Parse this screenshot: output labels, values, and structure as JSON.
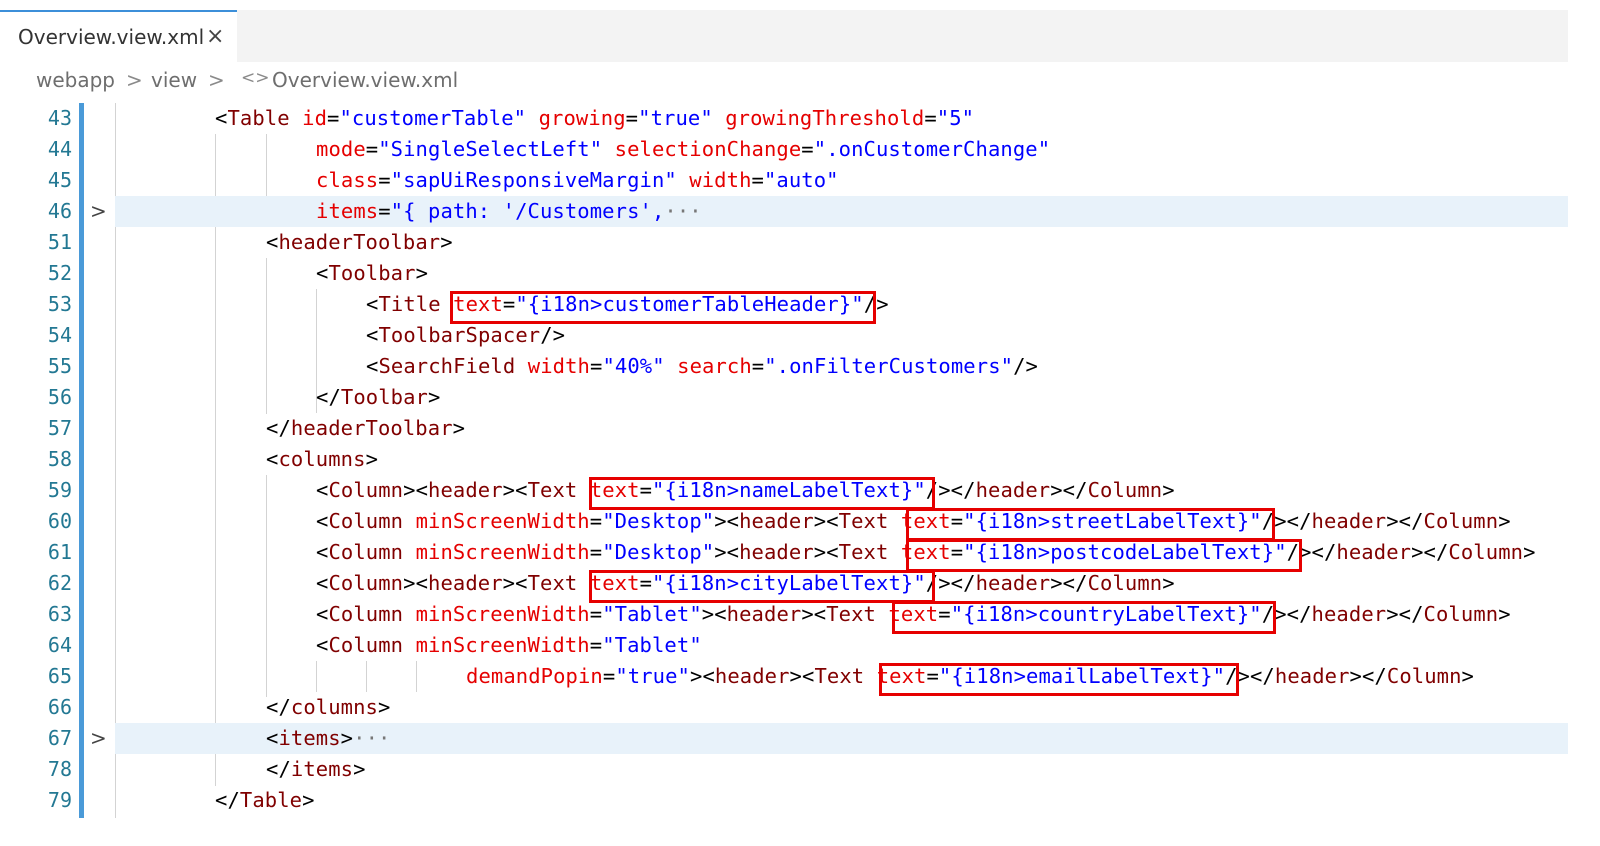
{
  "tab": {
    "label": "Overview.view.xml",
    "close_icon": "×"
  },
  "breadcrumb": {
    "items": [
      "webapp",
      "view",
      "Overview.view.xml"
    ],
    "separator": ">",
    "file_icon": "<>"
  },
  "lines": [
    {
      "num": "43",
      "text": "<Table id=\"customerTable\" growing=\"true\" growingThreshold=\"5\""
    },
    {
      "num": "44",
      "text": "mode=\"SingleSelectLeft\" selectionChange=\".onCustomerChange\""
    },
    {
      "num": "45",
      "text": "class=\"sapUiResponsiveMargin\" width=\"auto\""
    },
    {
      "num": "46",
      "text": "items=\"{ path: '/Customers',",
      "fold": ">",
      "folded": "···"
    },
    {
      "num": "51",
      "text": "<headerToolbar>"
    },
    {
      "num": "52",
      "text": "<Toolbar>"
    },
    {
      "num": "53",
      "text": "<Title text=\"{i18n>customerTableHeader}\"/>"
    },
    {
      "num": "54",
      "text": "<ToolbarSpacer/>"
    },
    {
      "num": "55",
      "text": "<SearchField width=\"40%\" search=\".onFilterCustomers\"/>"
    },
    {
      "num": "56",
      "text": "</Toolbar>"
    },
    {
      "num": "57",
      "text": "</headerToolbar>"
    },
    {
      "num": "58",
      "text": "<columns>"
    },
    {
      "num": "59",
      "text": "<Column><header><Text text=\"{i18n>nameLabelText}\"/></header></Column>"
    },
    {
      "num": "60",
      "text": "<Column minScreenWidth=\"Desktop\"><header><Text text=\"{i18n>streetLabelText}\"/></header></Column>"
    },
    {
      "num": "61",
      "text": "<Column minScreenWidth=\"Desktop\"><header><Text text=\"{i18n>postcodeLabelText}\"/></header></Column>"
    },
    {
      "num": "62",
      "text": "<Column><header><Text text=\"{i18n>cityLabelText}\"/></header></Column>"
    },
    {
      "num": "63",
      "text": "<Column minScreenWidth=\"Tablet\"><header><Text text=\"{i18n>countryLabelText}\"/></header></Column>"
    },
    {
      "num": "64",
      "text": "<Column minScreenWidth=\"Tablet\""
    },
    {
      "num": "65",
      "text": "demandPopin=\"true\"><header><Text text=\"{i18n>emailLabelText}\"/></header></Column>"
    },
    {
      "num": "66",
      "text": "</columns>"
    },
    {
      "num": "67",
      "text": "<items>",
      "fold": ">",
      "folded": "···"
    },
    {
      "num": "78",
      "text": "</items>"
    },
    {
      "num": "79",
      "text": "</Table>"
    }
  ],
  "colors": {
    "tag": "#800000",
    "attribute": "#e50000",
    "value": "#0000ff",
    "highlight": "#e8f2fa",
    "annotation": "#e60000"
  }
}
